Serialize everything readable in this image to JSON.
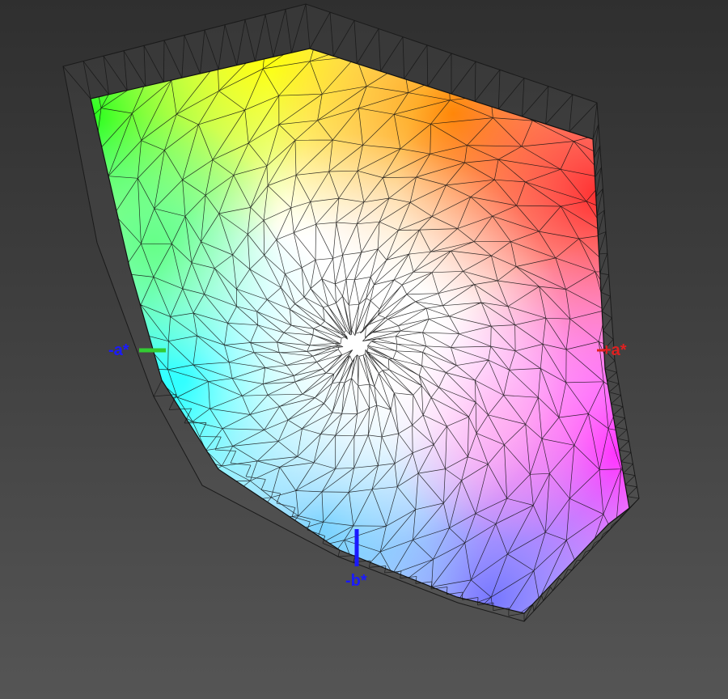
{
  "axes": {
    "neg_a": {
      "label": "-a*",
      "label_color": "#1a1aff",
      "line_color": "#33cc33"
    },
    "neg_b": {
      "label": "-b*",
      "label_color": "#1a1aff",
      "line_color": "#1a1aff"
    },
    "pos_a": {
      "label": "+a*",
      "label_color": "#e02020",
      "line_color": "#e02020"
    }
  },
  "surface": {
    "colors": {
      "green": "#22ff22",
      "yellow": "#ffff00",
      "orange": "#ff9900",
      "red": "#ff3030",
      "magenta": "#ff33ff",
      "blue": "#7777ff",
      "cyan": "#00ffff",
      "white": "#ffffff"
    },
    "wireframe_color": "#111111"
  }
}
